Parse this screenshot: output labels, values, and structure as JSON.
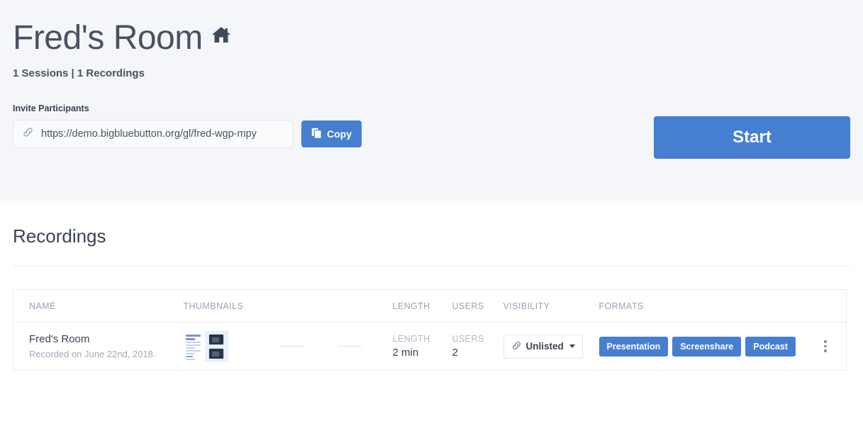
{
  "room": {
    "title": "Fred's Room",
    "home_icon": "home-icon",
    "subtitle": "1 Sessions | 1 Recordings"
  },
  "invite": {
    "label": "Invite Participants",
    "url": "https://demo.bigbluebutton.org/gl/fred-wgp-mpy",
    "link_icon": "link-icon",
    "copy_label": "Copy",
    "copy_icon": "copy-icon"
  },
  "start": {
    "label": "Start"
  },
  "recordings": {
    "heading": "Recordings",
    "columns": [
      "NAME",
      "THUMBNAILS",
      "LENGTH",
      "USERS",
      "VISIBILITY",
      "FORMATS",
      ""
    ],
    "rows": [
      {
        "name": "Fred's Room",
        "date": "Recorded on June 22nd, 2018.",
        "length_label": "LENGTH",
        "length": "2 min",
        "users_label": "USERS",
        "users": "2",
        "visibility": "Unlisted",
        "visibility_icon": "link-icon",
        "formats": [
          "Presentation",
          "Screenshare",
          "Podcast"
        ],
        "menu_icon": "kebab-menu-icon"
      }
    ]
  },
  "colors": {
    "accent": "#467fd0",
    "header_band": "#f5f6fa",
    "text": "#3b4252",
    "muted": "#9aa3b4"
  }
}
